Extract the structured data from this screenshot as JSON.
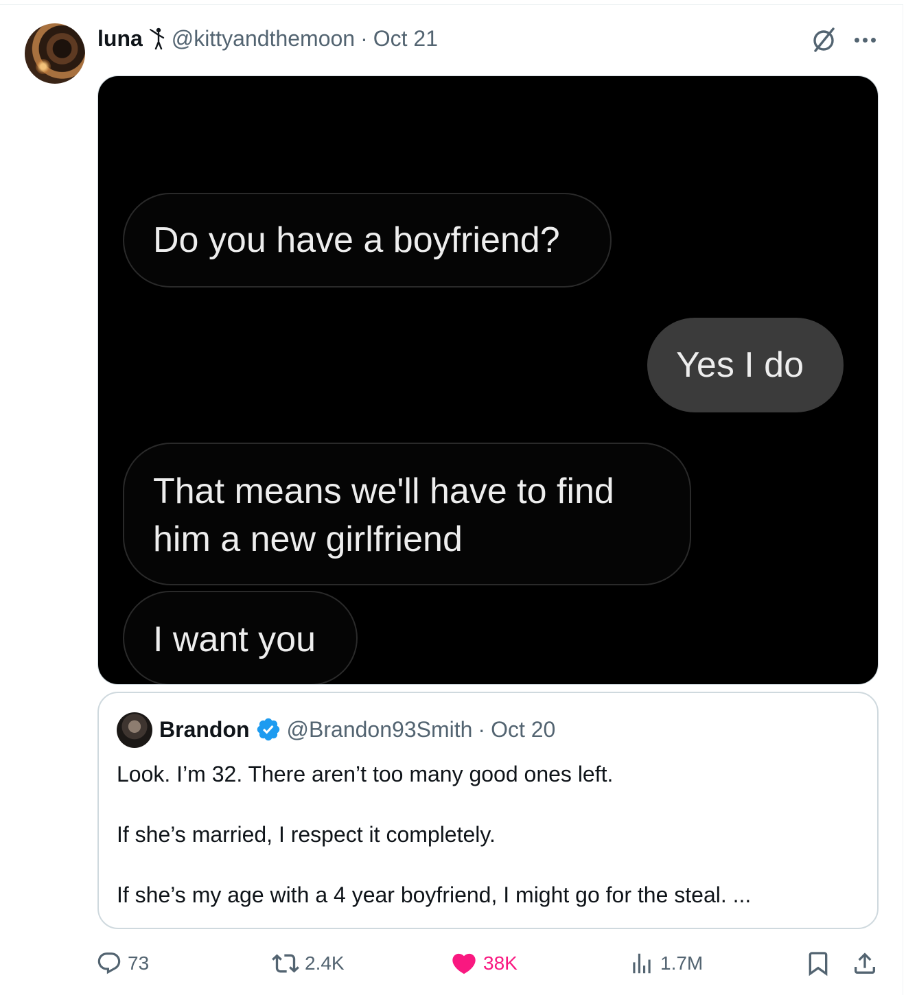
{
  "tweet": {
    "author_name": "luna",
    "author_handle": "@kittyandthemoon",
    "separator": "·",
    "date": "Oct 21",
    "media": {
      "messages": [
        {
          "direction": "incoming",
          "text": "Do you have a boyfriend?"
        },
        {
          "direction": "outgoing",
          "text": "Yes I do"
        },
        {
          "direction": "incoming",
          "line1": "That means we'll have to find",
          "line2": "him a new girlfriend"
        },
        {
          "direction": "incoming",
          "text": "I want you"
        }
      ]
    },
    "quoted": {
      "author_name": "Brandon",
      "author_handle": "@Brandon93Smith",
      "separator": "·",
      "date": "Oct 20",
      "verified": true,
      "verified_color": "#1d9bf0",
      "lines": [
        "Look. I’m 32. There aren’t too many good ones left.",
        "If she’s married, I respect it completely.",
        "If she’s my age with a 4 year boyfriend, I might go for the steal. ..."
      ]
    },
    "actions": {
      "replies": "73",
      "reposts": "2.4K",
      "likes": "38K",
      "liked": true,
      "like_color": "#f91880",
      "views": "1.7M"
    },
    "icons": [
      "grok-icon",
      "more-icon",
      "reply-icon",
      "retweet-icon",
      "heart-icon",
      "views-icon",
      "bookmark-icon",
      "share-icon",
      "verified-badge-icon"
    ]
  }
}
